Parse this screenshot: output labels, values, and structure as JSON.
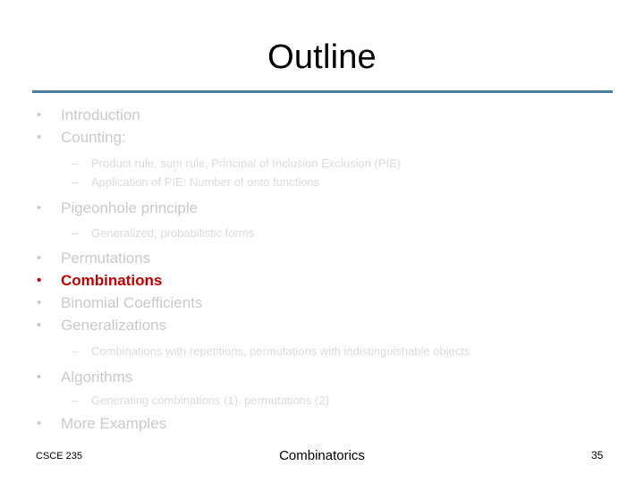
{
  "slide": {
    "title": "Outline",
    "accent_rule_color": "#4A7BA0",
    "body_text_color": "#C9C9CE",
    "sub_text_color": "#DBDBDF",
    "highlight_color": "#C00000",
    "bullet_glyph": "•",
    "dash_glyph": "–",
    "items": [
      {
        "level": 1,
        "text": "Introduction"
      },
      {
        "level": 1,
        "text": "Counting:"
      },
      {
        "level": 2,
        "text": "Product rule, sum rule, Principal of Inclusion Exclusion (PIE)"
      },
      {
        "level": 2,
        "text": "Application of PIE: Number of onto functions"
      },
      {
        "level": 1,
        "text": "Pigeonhole principle"
      },
      {
        "level": 2,
        "text": "Generalized, probabilistic forms"
      },
      {
        "level": 1,
        "text": "Permutations"
      },
      {
        "level": 1,
        "text": "Combinations",
        "highlight": true
      },
      {
        "level": 1,
        "text": "Binomial Coefficients"
      },
      {
        "level": 1,
        "text": "Generalizations"
      },
      {
        "level": 2,
        "text": "Combinations with repetitions, permutations with indistinguishable objects"
      },
      {
        "level": 1,
        "text": "Algorithms"
      },
      {
        "level": 2,
        "text": "Generating combinations (1), permutations (2)"
      },
      {
        "level": 1,
        "text": "More Examples"
      }
    ]
  },
  "footer": {
    "course": "CSCE 235",
    "topic": "Combinatorics",
    "page_number": "35"
  }
}
